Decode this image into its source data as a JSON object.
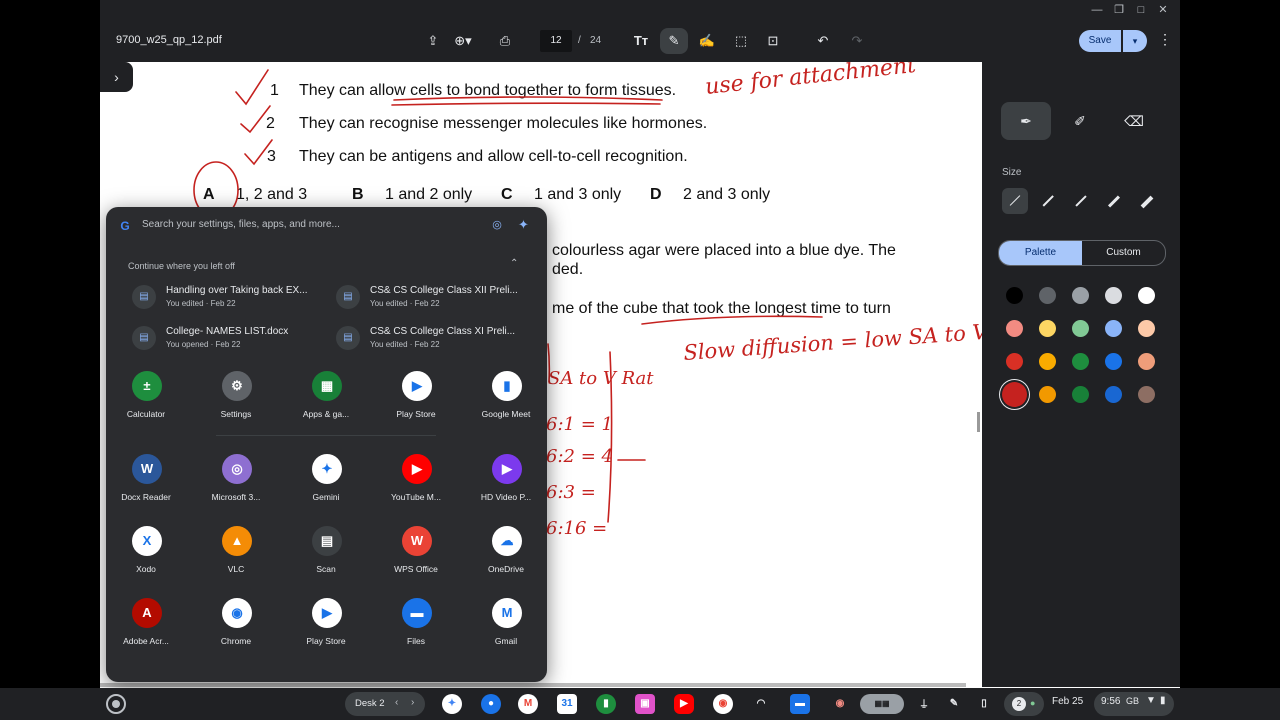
{
  "window": {
    "filename": "9700_w25_qp_12.pdf",
    "controls": [
      "—",
      "❐",
      "□",
      "✕"
    ]
  },
  "toolbar": {
    "page_current": "12",
    "page_separator": "/",
    "page_total": "24",
    "save_label": "Save",
    "icons": [
      "share-icon",
      "zoom-icon",
      "print-icon",
      "text-icon",
      "pen-icon",
      "highlighter-icon",
      "select-icon",
      "ocr-icon",
      "undo-icon",
      "redo-icon",
      "more-icon"
    ]
  },
  "document": {
    "statements": [
      {
        "num": "1",
        "text": "They can allow cells to bond together to form tissues."
      },
      {
        "num": "2",
        "text": "They can recognise messenger molecules like hormones."
      },
      {
        "num": "3",
        "text": "They can be antigens and allow cell-to-cell recognition."
      }
    ],
    "options": [
      {
        "letter": "A",
        "text": "1, 2 and 3"
      },
      {
        "letter": "B",
        "text": "1 and 2 only"
      },
      {
        "letter": "C",
        "text": "1 and 3 only"
      },
      {
        "letter": "D",
        "text": "2 and 3 only"
      }
    ],
    "partial_lines": [
      "colourless agar were placed into a blue dye. The",
      "ded.",
      "me of the cube that took the longest time to turn"
    ],
    "handwriting": {
      "note1": "use for attachment",
      "note2": "Slow diffusion = low SA to V Ratio",
      "ratio_header": "SA to V Rat",
      "ratios": [
        "6:1 = 1",
        "6:2 = 4",
        "6:3 =",
        "6:16 ="
      ]
    }
  },
  "annotation_panel": {
    "tools": [
      "pen-icon",
      "highlighter-icon",
      "eraser-icon"
    ],
    "size_label": "Size",
    "tab_palette": "Palette",
    "tab_custom": "Custom",
    "colors": [
      [
        "#000000",
        "#5f6368",
        "#9aa0a6",
        "#dadce0",
        "#ffffff"
      ],
      [
        "#f28b82",
        "#fdd663",
        "#81c995",
        "#8ab4f8",
        "#fcc9a8"
      ],
      [
        "#d93025",
        "#f9ab00",
        "#1e8e3e",
        "#1a73e8",
        "#ee9d7a"
      ],
      [
        "#c5221f",
        "#f29900",
        "#188038",
        "#1967d2",
        "#8d6e63"
      ]
    ],
    "selected_color": "#c5221f"
  },
  "launcher": {
    "search_placeholder": "Search your settings, files, apps, and more...",
    "continue_label": "Continue where you left off",
    "continue_items": [
      {
        "title": "Handling over Taking back EX...",
        "subtitle": "You edited · Feb 22"
      },
      {
        "title": "CS& CS College Class XII Preli...",
        "subtitle": "You edited · Feb 22"
      },
      {
        "title": "College- NAMES LIST.docx",
        "subtitle": "You opened · Feb 22"
      },
      {
        "title": "CS& CS College Class XI Preli...",
        "subtitle": "You edited · Feb 22"
      }
    ],
    "apps": [
      {
        "label": "Calculator",
        "icon": "calculator-icon",
        "color": "#1e8e3e",
        "glyph": "±"
      },
      {
        "label": "Settings",
        "icon": "settings-icon",
        "color": "#5f6368",
        "glyph": "⚙"
      },
      {
        "label": "Apps & ga...",
        "icon": "apps-games-icon",
        "color": "#188038",
        "glyph": "▦"
      },
      {
        "label": "Play Store",
        "icon": "play-store-icon",
        "color": "#ffffff",
        "glyph": "▶"
      },
      {
        "label": "Google Meet",
        "icon": "meet-icon",
        "color": "#ffffff",
        "glyph": "▮"
      },
      {
        "label": "Docx Reader",
        "icon": "word-icon",
        "color": "#2b579a",
        "glyph": "W"
      },
      {
        "label": "Microsoft 3...",
        "icon": "microsoft-365-icon",
        "color": "#8e6fd1",
        "glyph": "◎"
      },
      {
        "label": "Gemini",
        "icon": "gemini-icon",
        "color": "#ffffff",
        "glyph": "✦"
      },
      {
        "label": "YouTube M...",
        "icon": "youtube-music-icon",
        "color": "#ff0000",
        "glyph": "▶"
      },
      {
        "label": "HD Video P...",
        "icon": "video-player-icon",
        "color": "#7c3aed",
        "glyph": "▶"
      },
      {
        "label": "Xodo",
        "icon": "xodo-icon",
        "color": "#ffffff",
        "glyph": "X"
      },
      {
        "label": "VLC",
        "icon": "vlc-icon",
        "color": "#f48c06",
        "glyph": "▲"
      },
      {
        "label": "Scan",
        "icon": "scan-icon",
        "color": "#3c4043",
        "glyph": "▤"
      },
      {
        "label": "WPS Office",
        "icon": "wps-icon",
        "color": "#ea4335",
        "glyph": "W"
      },
      {
        "label": "OneDrive",
        "icon": "onedrive-icon",
        "color": "#ffffff",
        "glyph": "☁"
      },
      {
        "label": "Adobe Acr...",
        "icon": "adobe-acrobat-icon",
        "color": "#b30b00",
        "glyph": "A"
      },
      {
        "label": "Chrome",
        "icon": "chrome-icon",
        "color": "#ffffff",
        "glyph": "◉"
      },
      {
        "label": "Play Store",
        "icon": "play-store-icon",
        "color": "#ffffff",
        "glyph": "▶"
      },
      {
        "label": "Files",
        "icon": "files-icon",
        "color": "#1a73e8",
        "glyph": "▬"
      },
      {
        "label": "Gmail",
        "icon": "gmail-icon",
        "color": "#ffffff",
        "glyph": "M"
      }
    ]
  },
  "shelf": {
    "desk_name": "Desk 2",
    "date": "Feb 25",
    "time": "9:56",
    "storage": "GB",
    "notifications": "2"
  }
}
